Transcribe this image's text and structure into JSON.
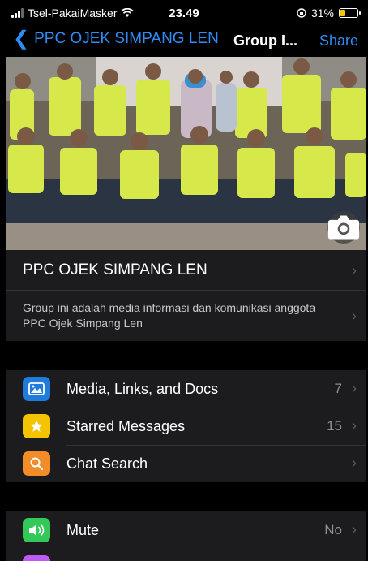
{
  "status_bar": {
    "carrier": "Tsel-PakaiMasker",
    "time": "23.49",
    "battery": "31%",
    "battery_level": 0.31
  },
  "nav": {
    "back_label": "PPC OJEK SIMPANG LEN",
    "title": "Group I...",
    "share_label": "Share"
  },
  "group": {
    "name": "PPC OJEK SIMPANG LEN",
    "description": "Group ini adalah media informasi dan komunikasi anggota PPC Ojek Simpang Len"
  },
  "menu": {
    "media": {
      "label": "Media, Links, and Docs",
      "value": "7"
    },
    "starred": {
      "label": "Starred Messages",
      "value": "15"
    },
    "search": {
      "label": "Chat Search",
      "value": ""
    },
    "mute": {
      "label": "Mute",
      "value": "No"
    }
  },
  "colors": {
    "accent": "#2f8cf5",
    "media_icon": "#1f7bdc",
    "starred_icon": "#f5c400",
    "search_icon": "#f28c28",
    "mute_icon": "#34c759"
  },
  "icons": {
    "back": "chevron-left-icon",
    "camera": "camera-icon",
    "media": "photo-icon",
    "starred": "star-icon",
    "search": "magnifier-icon",
    "mute": "speaker-icon"
  }
}
